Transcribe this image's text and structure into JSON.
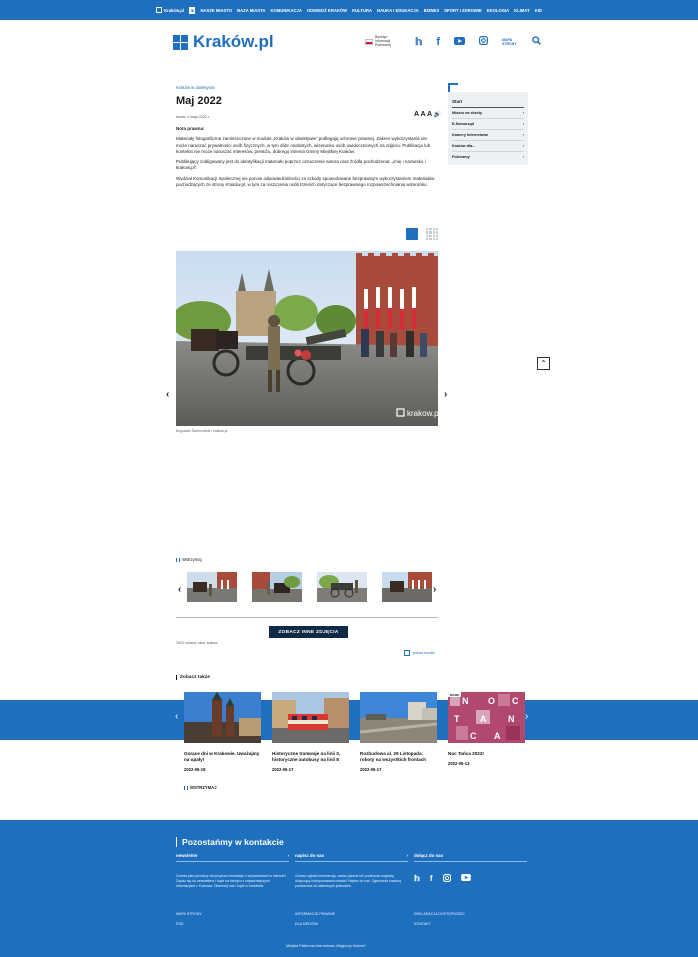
{
  "topbar": {
    "home": "Kraków.pl",
    "items": [
      "NASZE MIASTO",
      "BAZA MIASTA",
      "KOMUNIKACJA",
      "ODWIEDŹ KRAKÓW",
      "KULTURA",
      "NAUKA I EDUKACJA",
      "BIZNES",
      "SPORT I ZDROWIE",
      "EKOLOGIA",
      "KLIMAT",
      "KID"
    ]
  },
  "header": {
    "logo": "Kraków.pl",
    "bip_label": "Biuletyn Informacji Publicznej",
    "map_label": "MAPA STRONY"
  },
  "article": {
    "breadcrumb": "Kraków w obiektywie",
    "title": "Maj 2022",
    "date": "środa, 4 maja 2022 r.",
    "font_controls": "A A A",
    "note_title": "Nota prawna:",
    "p1": "Materiały fotograficzne zamieszczane w module „Kraków w obiektywie” podlegają ochronie prawnej. Zakres wykorzystania nie może naruszać prywatności osób fizycznych, w tym dóbr osobistych, wizerunku osób uwidocznionych na zdjęciu. Publikacja lub kontekst nie może naruszać interesów, prestiżu, dobrego imienia Gminy Miejskiej Kraków.",
    "p2": "Publikujący zobligowany jest do identyfikacji materiału poprzez oznaczenie autora oraz źródła pochodzenia: „imię i nazwisko / krakow.pl”.",
    "p3": "Wydział Komunikacji Społecznej nie ponosi odpowiedzialności za szkody spowodowane bezprawnym wykorzystaniem materiałów pochodzących ze strony Kraków.pl, w tym za roszczenia osób trzecich dotyczące bezprawnego rozpowszechniania wizerunku.",
    "photo_caption": "Bogusław Świerzowski / krakow.pl",
    "watermark": "krakow.pl",
    "pause_label": "Wstrzymaj",
    "more_button": "ZOBACZ INNE ZDJĘCIA",
    "tags": "TAGI: wiosna, ulice, krakow",
    "print": "pokaż media"
  },
  "sidebar": {
    "start": "Start",
    "items": [
      "Miasto na skróty",
      "E-Samorząd",
      "Kamery Internetowe",
      "Kraków dla...",
      "Polecamy"
    ]
  },
  "see_also": {
    "heading": "Zobacz także",
    "badge": "NOWE",
    "cards": [
      {
        "title": "Gorące dni w Krakowie. Uważajmy na upały!",
        "date": "2022-06-18"
      },
      {
        "title": "Historyczne tramwaje na linii 0, historyczne autobusy na linii E",
        "date": "2022-06-17"
      },
      {
        "title": "Rozbudowa al. 29 Listopada: roboty na wszystkich frontach",
        "date": "2022-06-17"
      },
      {
        "title": "Noc Tańca 2022!",
        "date": "2022-06-13"
      }
    ],
    "noc_letters": [
      "N",
      "O",
      "C",
      "T",
      "A",
      "N",
      "C",
      "A"
    ],
    "pause_label": "WSTRZYMAJ"
  },
  "footer": {
    "title": "Pozostańmy w kontakcie",
    "col1_head": "newsletter",
    "col1_text": "Chcesz jako pierwszy otrzymywać informacje o wydarzeniach w mieście? Zapisz się do newslettera i bądź na bieżąco z najważniejszymi informacjami z Krakowa. Obserwuj nas i bądź w kontakcie.",
    "col2_head": "napisz do nas",
    "col2_text": "Chcesz zgłosić interwencję, zadać pytanie lub przekazać sugestię dotyczącą funkcjonowania miasta? Napisz do nas. Zgłoszenia zostaną przekazane do właściwych jednostek.",
    "col3_head": "dołącz do nas",
    "links_col1": [
      "MAPA STRONY",
      "RSS"
    ],
    "links_col2": [
      "INFORMACJE PRAWNE",
      "DLA MEDIÓW"
    ],
    "links_col3": [
      "DEKLARACJA DOSTĘPNOŚCI",
      "KONTAKT"
    ],
    "bottom": "Miejska Platforma Internetowa „Magiczny Kraków”"
  },
  "colors": {
    "brand_blue": "#1f6fbf",
    "dark_navy": "#0e2a47"
  }
}
